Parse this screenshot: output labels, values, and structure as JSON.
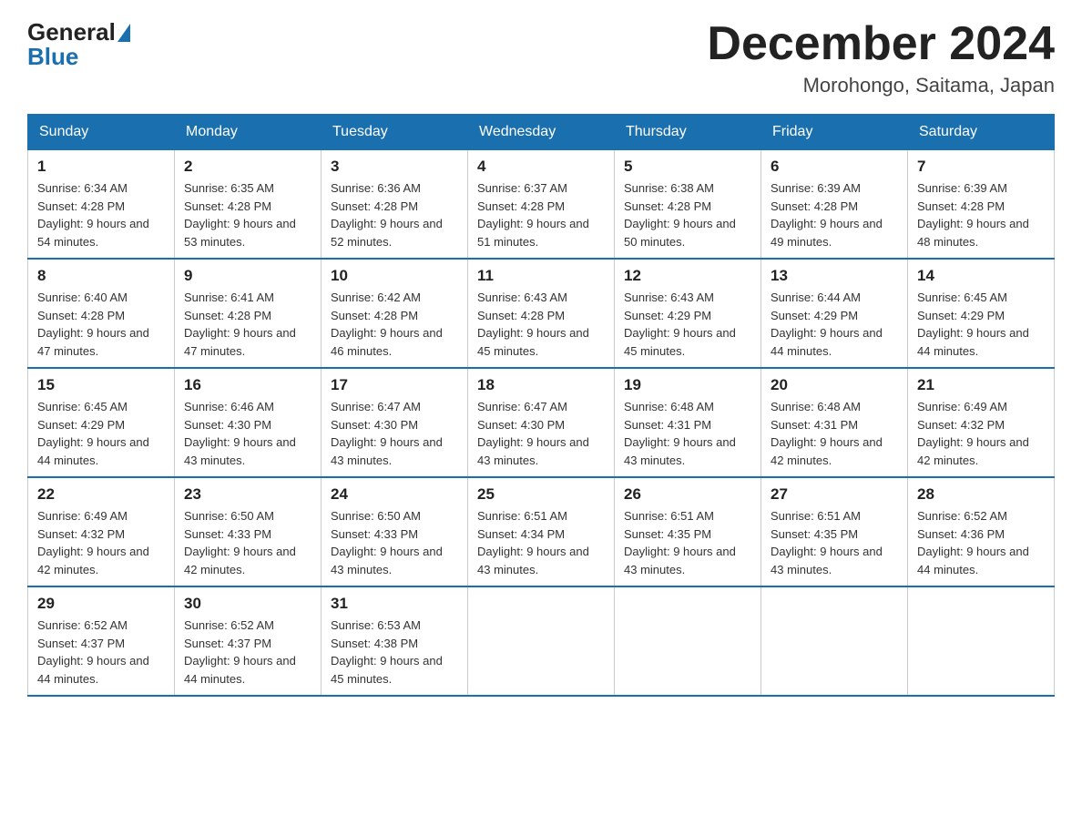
{
  "header": {
    "logo_general": "General",
    "logo_blue": "Blue",
    "month_title": "December 2024",
    "location": "Morohongo, Saitama, Japan"
  },
  "days_of_week": [
    "Sunday",
    "Monday",
    "Tuesday",
    "Wednesday",
    "Thursday",
    "Friday",
    "Saturday"
  ],
  "weeks": [
    [
      {
        "day": "1",
        "sunrise": "6:34 AM",
        "sunset": "4:28 PM",
        "daylight": "9 hours and 54 minutes."
      },
      {
        "day": "2",
        "sunrise": "6:35 AM",
        "sunset": "4:28 PM",
        "daylight": "9 hours and 53 minutes."
      },
      {
        "day": "3",
        "sunrise": "6:36 AM",
        "sunset": "4:28 PM",
        "daylight": "9 hours and 52 minutes."
      },
      {
        "day": "4",
        "sunrise": "6:37 AM",
        "sunset": "4:28 PM",
        "daylight": "9 hours and 51 minutes."
      },
      {
        "day": "5",
        "sunrise": "6:38 AM",
        "sunset": "4:28 PM",
        "daylight": "9 hours and 50 minutes."
      },
      {
        "day": "6",
        "sunrise": "6:39 AM",
        "sunset": "4:28 PM",
        "daylight": "9 hours and 49 minutes."
      },
      {
        "day": "7",
        "sunrise": "6:39 AM",
        "sunset": "4:28 PM",
        "daylight": "9 hours and 48 minutes."
      }
    ],
    [
      {
        "day": "8",
        "sunrise": "6:40 AM",
        "sunset": "4:28 PM",
        "daylight": "9 hours and 47 minutes."
      },
      {
        "day": "9",
        "sunrise": "6:41 AM",
        "sunset": "4:28 PM",
        "daylight": "9 hours and 47 minutes."
      },
      {
        "day": "10",
        "sunrise": "6:42 AM",
        "sunset": "4:28 PM",
        "daylight": "9 hours and 46 minutes."
      },
      {
        "day": "11",
        "sunrise": "6:43 AM",
        "sunset": "4:28 PM",
        "daylight": "9 hours and 45 minutes."
      },
      {
        "day": "12",
        "sunrise": "6:43 AM",
        "sunset": "4:29 PM",
        "daylight": "9 hours and 45 minutes."
      },
      {
        "day": "13",
        "sunrise": "6:44 AM",
        "sunset": "4:29 PM",
        "daylight": "9 hours and 44 minutes."
      },
      {
        "day": "14",
        "sunrise": "6:45 AM",
        "sunset": "4:29 PM",
        "daylight": "9 hours and 44 minutes."
      }
    ],
    [
      {
        "day": "15",
        "sunrise": "6:45 AM",
        "sunset": "4:29 PM",
        "daylight": "9 hours and 44 minutes."
      },
      {
        "day": "16",
        "sunrise": "6:46 AM",
        "sunset": "4:30 PM",
        "daylight": "9 hours and 43 minutes."
      },
      {
        "day": "17",
        "sunrise": "6:47 AM",
        "sunset": "4:30 PM",
        "daylight": "9 hours and 43 minutes."
      },
      {
        "day": "18",
        "sunrise": "6:47 AM",
        "sunset": "4:30 PM",
        "daylight": "9 hours and 43 minutes."
      },
      {
        "day": "19",
        "sunrise": "6:48 AM",
        "sunset": "4:31 PM",
        "daylight": "9 hours and 43 minutes."
      },
      {
        "day": "20",
        "sunrise": "6:48 AM",
        "sunset": "4:31 PM",
        "daylight": "9 hours and 42 minutes."
      },
      {
        "day": "21",
        "sunrise": "6:49 AM",
        "sunset": "4:32 PM",
        "daylight": "9 hours and 42 minutes."
      }
    ],
    [
      {
        "day": "22",
        "sunrise": "6:49 AM",
        "sunset": "4:32 PM",
        "daylight": "9 hours and 42 minutes."
      },
      {
        "day": "23",
        "sunrise": "6:50 AM",
        "sunset": "4:33 PM",
        "daylight": "9 hours and 42 minutes."
      },
      {
        "day": "24",
        "sunrise": "6:50 AM",
        "sunset": "4:33 PM",
        "daylight": "9 hours and 43 minutes."
      },
      {
        "day": "25",
        "sunrise": "6:51 AM",
        "sunset": "4:34 PM",
        "daylight": "9 hours and 43 minutes."
      },
      {
        "day": "26",
        "sunrise": "6:51 AM",
        "sunset": "4:35 PM",
        "daylight": "9 hours and 43 minutes."
      },
      {
        "day": "27",
        "sunrise": "6:51 AM",
        "sunset": "4:35 PM",
        "daylight": "9 hours and 43 minutes."
      },
      {
        "day": "28",
        "sunrise": "6:52 AM",
        "sunset": "4:36 PM",
        "daylight": "9 hours and 44 minutes."
      }
    ],
    [
      {
        "day": "29",
        "sunrise": "6:52 AM",
        "sunset": "4:37 PM",
        "daylight": "9 hours and 44 minutes."
      },
      {
        "day": "30",
        "sunrise": "6:52 AM",
        "sunset": "4:37 PM",
        "daylight": "9 hours and 44 minutes."
      },
      {
        "day": "31",
        "sunrise": "6:53 AM",
        "sunset": "4:38 PM",
        "daylight": "9 hours and 45 minutes."
      },
      null,
      null,
      null,
      null
    ]
  ]
}
